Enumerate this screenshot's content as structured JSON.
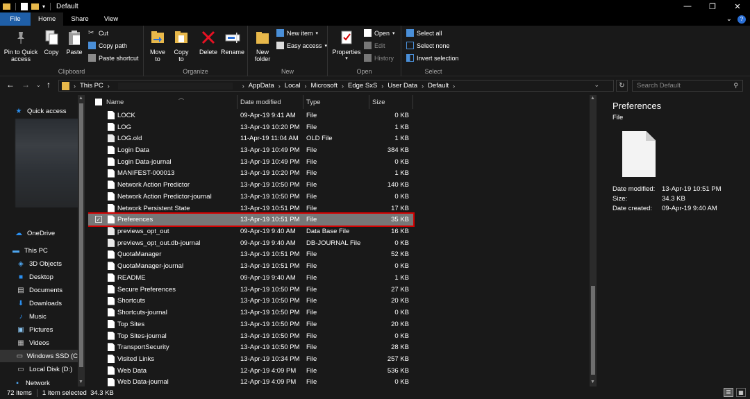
{
  "window": {
    "title": "Default",
    "minimize": "—",
    "restore": "❐",
    "close": "✕"
  },
  "tabs": [
    {
      "label": "File"
    },
    {
      "label": "Home"
    },
    {
      "label": "Share"
    },
    {
      "label": "View"
    }
  ],
  "ribbon": {
    "clipboard": {
      "label": "Clipboard",
      "pin": "Pin to Quick access",
      "copy": "Copy",
      "paste": "Paste",
      "cut": "Cut",
      "copy_path": "Copy path",
      "paste_shortcut": "Paste shortcut"
    },
    "organize": {
      "label": "Organize",
      "move_to": "Move to",
      "copy_to": "Copy to",
      "delete": "Delete",
      "rename": "Rename"
    },
    "new": {
      "label": "New",
      "new_folder": "New folder",
      "new_item": "New item",
      "easy_access": "Easy access"
    },
    "open": {
      "label": "Open",
      "properties": "Properties",
      "open": "Open",
      "edit": "Edit",
      "history": "History"
    },
    "select": {
      "label": "Select",
      "select_all": "Select all",
      "select_none": "Select none",
      "invert_selection": "Invert selection"
    }
  },
  "address": {
    "this_pc": "This PC",
    "crumbs": [
      "AppData",
      "Local",
      "Microsoft",
      "Edge SxS",
      "User Data",
      "Default"
    ],
    "search_placeholder": "Search Default"
  },
  "nav": {
    "quick_access": "Quick access",
    "onedrive": "OneDrive",
    "this_pc": "This PC",
    "objects3d": "3D Objects",
    "desktop": "Desktop",
    "documents": "Documents",
    "downloads": "Downloads",
    "music": "Music",
    "pictures": "Pictures",
    "videos": "Videos",
    "windows_ssd": "Windows SSD (C",
    "local_disk": "Local Disk (D:)",
    "network": "Network"
  },
  "columns": {
    "name": "Name",
    "date": "Date modified",
    "type": "Type",
    "size": "Size"
  },
  "files": [
    {
      "name": "LOCK",
      "date": "09-Apr-19 9:41 AM",
      "type": "File",
      "size": "0 KB"
    },
    {
      "name": "LOG",
      "date": "13-Apr-19 10:20 PM",
      "type": "File",
      "size": "1 KB"
    },
    {
      "name": "LOG.old",
      "date": "11-Apr-19 11:04 AM",
      "type": "OLD File",
      "size": "1 KB"
    },
    {
      "name": "Login Data",
      "date": "13-Apr-19 10:49 PM",
      "type": "File",
      "size": "384 KB"
    },
    {
      "name": "Login Data-journal",
      "date": "13-Apr-19 10:49 PM",
      "type": "File",
      "size": "0 KB"
    },
    {
      "name": "MANIFEST-000013",
      "date": "13-Apr-19 10:20 PM",
      "type": "File",
      "size": "1 KB"
    },
    {
      "name": "Network Action Predictor",
      "date": "13-Apr-19 10:50 PM",
      "type": "File",
      "size": "140 KB"
    },
    {
      "name": "Network Action Predictor-journal",
      "date": "13-Apr-19 10:50 PM",
      "type": "File",
      "size": "0 KB"
    },
    {
      "name": "Network Persistent State",
      "date": "13-Apr-19 10:51 PM",
      "type": "File",
      "size": "17 KB"
    },
    {
      "name": "Preferences",
      "date": "13-Apr-19 10:51 PM",
      "type": "File",
      "size": "35 KB"
    },
    {
      "name": "previews_opt_out",
      "date": "09-Apr-19 9:40 AM",
      "type": "Data Base File",
      "size": "16 KB"
    },
    {
      "name": "previews_opt_out.db-journal",
      "date": "09-Apr-19 9:40 AM",
      "type": "DB-JOURNAL File",
      "size": "0 KB"
    },
    {
      "name": "QuotaManager",
      "date": "13-Apr-19 10:51 PM",
      "type": "File",
      "size": "52 KB"
    },
    {
      "name": "QuotaManager-journal",
      "date": "13-Apr-19 10:51 PM",
      "type": "File",
      "size": "0 KB"
    },
    {
      "name": "README",
      "date": "09-Apr-19 9:40 AM",
      "type": "File",
      "size": "1 KB"
    },
    {
      "name": "Secure Preferences",
      "date": "13-Apr-19 10:50 PM",
      "type": "File",
      "size": "27 KB"
    },
    {
      "name": "Shortcuts",
      "date": "13-Apr-19 10:50 PM",
      "type": "File",
      "size": "20 KB"
    },
    {
      "name": "Shortcuts-journal",
      "date": "13-Apr-19 10:50 PM",
      "type": "File",
      "size": "0 KB"
    },
    {
      "name": "Top Sites",
      "date": "13-Apr-19 10:50 PM",
      "type": "File",
      "size": "20 KB"
    },
    {
      "name": "Top Sites-journal",
      "date": "13-Apr-19 10:50 PM",
      "type": "File",
      "size": "0 KB"
    },
    {
      "name": "TransportSecurity",
      "date": "13-Apr-19 10:50 PM",
      "type": "File",
      "size": "28 KB"
    },
    {
      "name": "Visited Links",
      "date": "13-Apr-19 10:34 PM",
      "type": "File",
      "size": "257 KB"
    },
    {
      "name": "Web Data",
      "date": "12-Apr-19 4:09 PM",
      "type": "File",
      "size": "536 KB"
    },
    {
      "name": "Web Data-journal",
      "date": "12-Apr-19 4:09 PM",
      "type": "File",
      "size": "0 KB"
    }
  ],
  "selected_index": 9,
  "preview": {
    "title": "Preferences",
    "type": "File",
    "date_modified_label": "Date modified:",
    "date_modified": "13-Apr-19 10:51 PM",
    "size_label": "Size:",
    "size": "34.3 KB",
    "date_created_label": "Date created:",
    "date_created": "09-Apr-19 9:40 AM"
  },
  "status": {
    "items": "72 items",
    "selected": "1 item selected  34.3 KB"
  },
  "colors": {
    "file_tab": "#1f5fa8",
    "selection": "#777777",
    "selection_outline": "#d40000",
    "background": "#191919"
  }
}
